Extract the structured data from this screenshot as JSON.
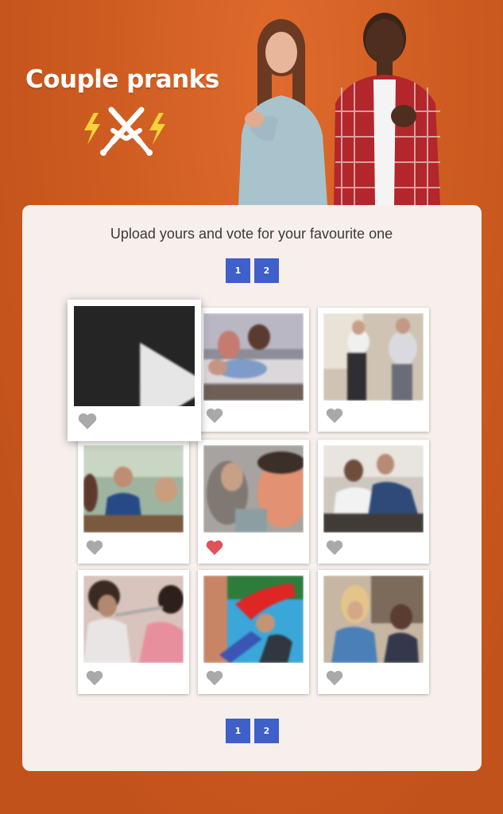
{
  "header": {
    "title": "Couple pranks"
  },
  "section": {
    "subtitle": "Upload yours and vote for your favourite one"
  },
  "pagination_top": {
    "pages": [
      "1",
      "2"
    ]
  },
  "pagination_bottom": {
    "pages": [
      "1",
      "2"
    ]
  },
  "grid": {
    "items": [
      {
        "kind": "video",
        "liked": false
      },
      {
        "kind": "photo",
        "liked": false
      },
      {
        "kind": "photo",
        "liked": false
      },
      {
        "kind": "photo",
        "liked": false
      },
      {
        "kind": "photo",
        "liked": true
      },
      {
        "kind": "photo",
        "liked": false
      },
      {
        "kind": "photo",
        "liked": false
      },
      {
        "kind": "photo",
        "liked": false
      },
      {
        "kind": "photo",
        "liked": false
      }
    ]
  },
  "colors": {
    "background": "#c8571f",
    "card": "#f6efeb",
    "pager": "#3f5fc9",
    "heart_liked": "#e0525a",
    "heart_default": "#a9a9a9"
  }
}
